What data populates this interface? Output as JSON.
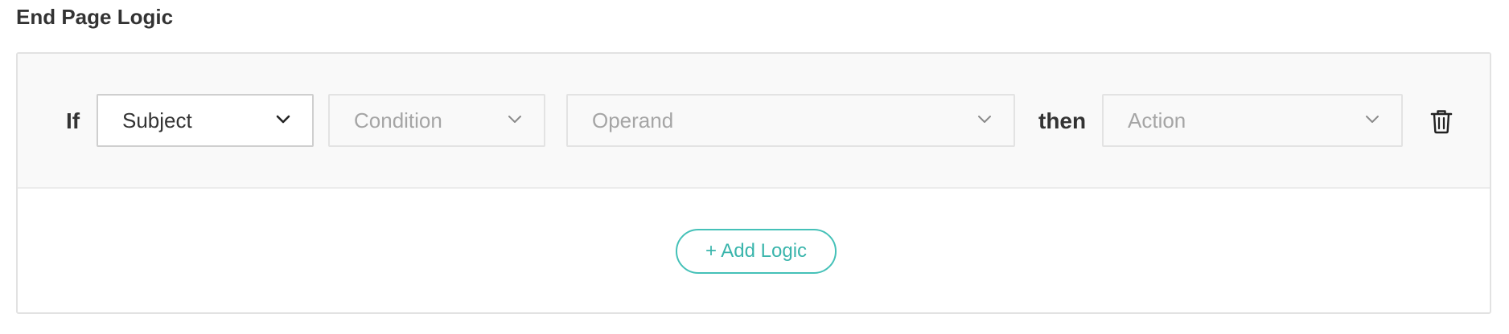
{
  "page_title": "End Page Logic",
  "logic_rule": {
    "if_label": "If",
    "then_label": "then",
    "subject": {
      "value": "Subject"
    },
    "condition": {
      "placeholder": "Condition"
    },
    "operand": {
      "placeholder": "Operand"
    },
    "action": {
      "placeholder": "Action"
    },
    "delete_icon": "trash-icon"
  },
  "add_logic": {
    "label": "+ Add Logic",
    "color": "#45c1b8"
  }
}
